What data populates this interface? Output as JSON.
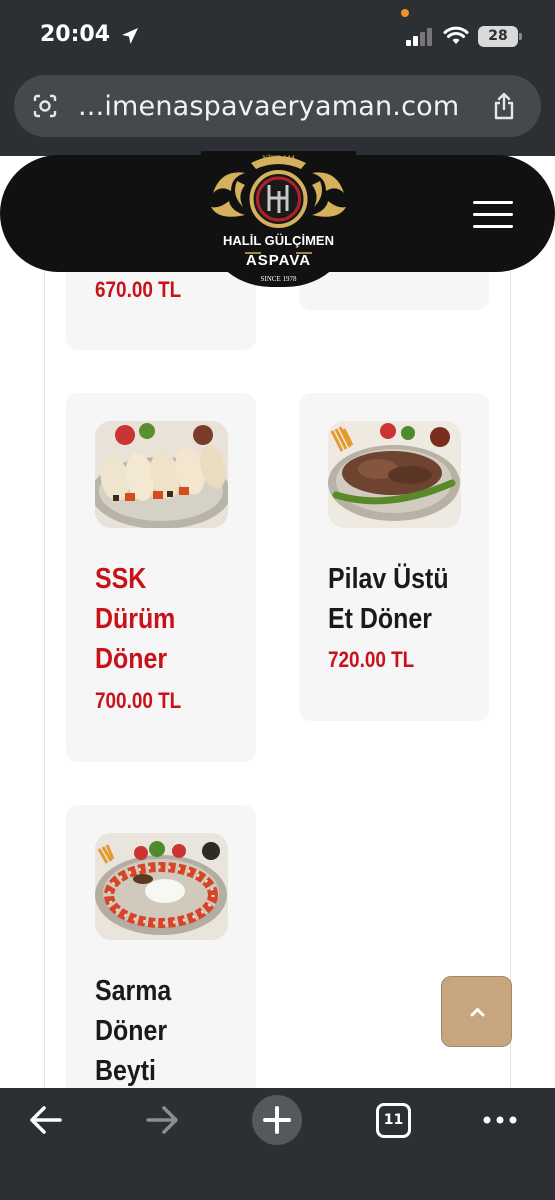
{
  "status_bar": {
    "time": "20:04",
    "battery": "28",
    "icons": [
      "location-arrow-icon",
      "signal-icon",
      "wifi-icon",
      "battery-icon"
    ]
  },
  "browser": {
    "url": "...imenaspavaeryaman.com",
    "icons": [
      "lens-icon",
      "share-icon"
    ]
  },
  "header": {
    "logo": {
      "top_text": "NİKRAM",
      "name": "HALİL GÜLÇİMEN",
      "brand": "ASPAVA",
      "since": "SINCE 1978"
    },
    "menu_icon": "hamburger-icon"
  },
  "menu": {
    "items": [
      {
        "name_lines": [],
        "price": "670.00 TL"
      },
      {
        "name_lines": [
          "SSK",
          "Dürüm",
          "Döner"
        ],
        "price": "700.00 TL",
        "name_color": "#c9111a"
      },
      {
        "name_lines": [
          "Pilav Üstü",
          "Et Döner"
        ],
        "price": "720.00 TL",
        "name_color": "#1a1a1a"
      },
      {
        "name_lines": [
          "Sarma",
          "Döner",
          "Beyti"
        ],
        "name_color": "#1a1a1a"
      }
    ]
  },
  "back_to_top": {
    "icon": "chevron-up-icon"
  },
  "toolbar": {
    "tabs_count": "11",
    "icons": [
      "back-arrow-icon",
      "forward-arrow-icon",
      "new-tab-plus-icon",
      "tabs-icon",
      "more-icon"
    ]
  },
  "colors": {
    "price": "#c9111a",
    "header": "#111111",
    "gold": "#d4b15a",
    "back_to_top": "#c7a57e",
    "browser_chrome": "#2c2f33"
  }
}
